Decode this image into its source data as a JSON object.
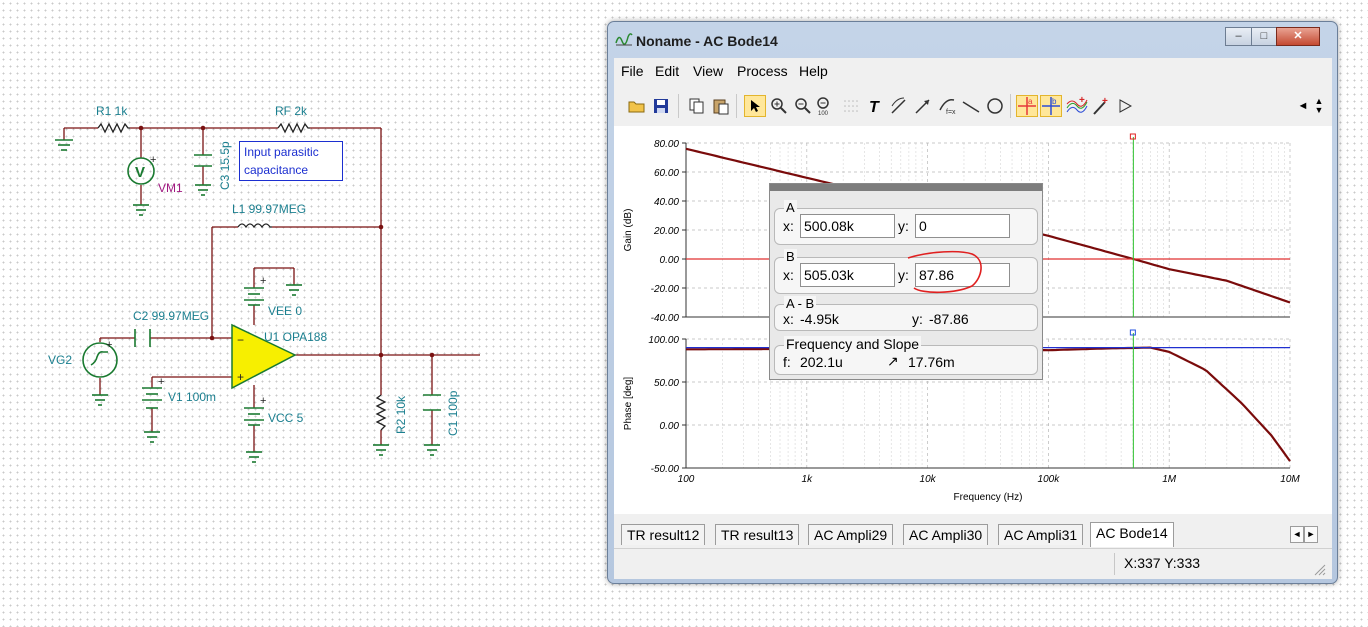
{
  "schematic": {
    "labels": {
      "r1": "R1 1k",
      "rf": "RF 2k",
      "c3": "C3 15.5p",
      "vm1": "VM1",
      "l1": "L1 99.97MEG",
      "vee": "VEE 0",
      "c2": "C2 99.97MEG",
      "u1": "U1 OPA188",
      "vg2": "VG2",
      "v1": "V1 100m",
      "vcc": "VCC 5",
      "r2": "R2 10k",
      "c1": "C1 100p"
    },
    "annotation": [
      "Input parasitic",
      "capacitance"
    ],
    "meter_symbol": "V"
  },
  "window": {
    "title": "Noname - AC Bode14",
    "menu": [
      "File",
      "Edit",
      "View",
      "Process",
      "Help"
    ],
    "toolbar_icons": [
      "open-icon",
      "save-icon",
      "copy-icon",
      "paste-icon",
      "pointer-icon",
      "zoom-in-icon",
      "zoom-out-icon",
      "zoom-100-icon",
      "grid-icon",
      "text-icon",
      "line-label-icon",
      "arrow-label-icon",
      "formula-icon",
      "line-icon",
      "ellipse-icon",
      "cursor-a-icon",
      "cursor-b-icon",
      "curve-add-icon",
      "marker-icon",
      "play-icon"
    ]
  },
  "chart_data": [
    {
      "type": "line",
      "ylabel": "Gain (dB)",
      "xscale": "log",
      "xlim": [
        100,
        10000000
      ],
      "ylim": [
        -40,
        80
      ],
      "yticks": [
        "80.00",
        "60.00",
        "40.00",
        "20.00",
        "0.00",
        "-20.00",
        "-40.00"
      ],
      "series": [
        {
          "color": "#7a0b0b",
          "x": [
            100,
            1000,
            10000,
            100000,
            505030,
            1000000,
            3000000,
            10000000
          ],
          "y": [
            76,
            56,
            36,
            16,
            0,
            -7,
            -15,
            -30
          ]
        },
        {
          "color": "#e03030",
          "x": [
            100,
            10000000
          ],
          "y": [
            0,
            0
          ]
        }
      ],
      "cursor_x": 505030,
      "grid": true
    },
    {
      "type": "line",
      "ylabel": "Phase [deg]",
      "xlabel": "Frequency (Hz)",
      "xscale": "log",
      "xlim": [
        100,
        10000000
      ],
      "ylim": [
        -50,
        100
      ],
      "yticks": [
        "100.00",
        "50.00",
        "0.00",
        "-50.00"
      ],
      "xticks": [
        "100",
        "1k",
        "10k",
        "100k",
        "1M",
        "10M"
      ],
      "series": [
        {
          "color": "#7a0b0b",
          "x": [
            100,
            10000,
            100000,
            300000,
            700000,
            1000000,
            2000000,
            4000000,
            7000000,
            10000000
          ],
          "y": [
            88,
            89,
            87,
            89,
            90,
            85,
            64,
            25,
            -12,
            -42
          ]
        },
        {
          "color": "#2030d0",
          "x": [
            100,
            10000000
          ],
          "y": [
            90,
            90
          ]
        }
      ],
      "cursor_x": 505030,
      "grid": true
    }
  ],
  "cursor_dialog": {
    "a": {
      "title": "A",
      "x_label": "x:",
      "x": "500.08k",
      "y_label": "y:",
      "y": "0"
    },
    "b": {
      "title": "B",
      "x_label": "x:",
      "x": "505.03k",
      "y_label": "y:",
      "y": "87.86"
    },
    "diff": {
      "title": "A - B",
      "x_label": "x:",
      "x": "-4.95k",
      "y_label": "y:",
      "y": "-87.86"
    },
    "freq": {
      "title": "Frequency and Slope",
      "f_label": "f:",
      "f": "202.1u",
      "slope": "17.76m"
    }
  },
  "tabs": [
    "TR result12",
    "TR result13",
    "AC Ampli29",
    "AC Ampli30",
    "AC Ampli31",
    "AC Bode14"
  ],
  "active_tab": "AC Bode14",
  "status": {
    "coords": "X:337 Y:333"
  }
}
